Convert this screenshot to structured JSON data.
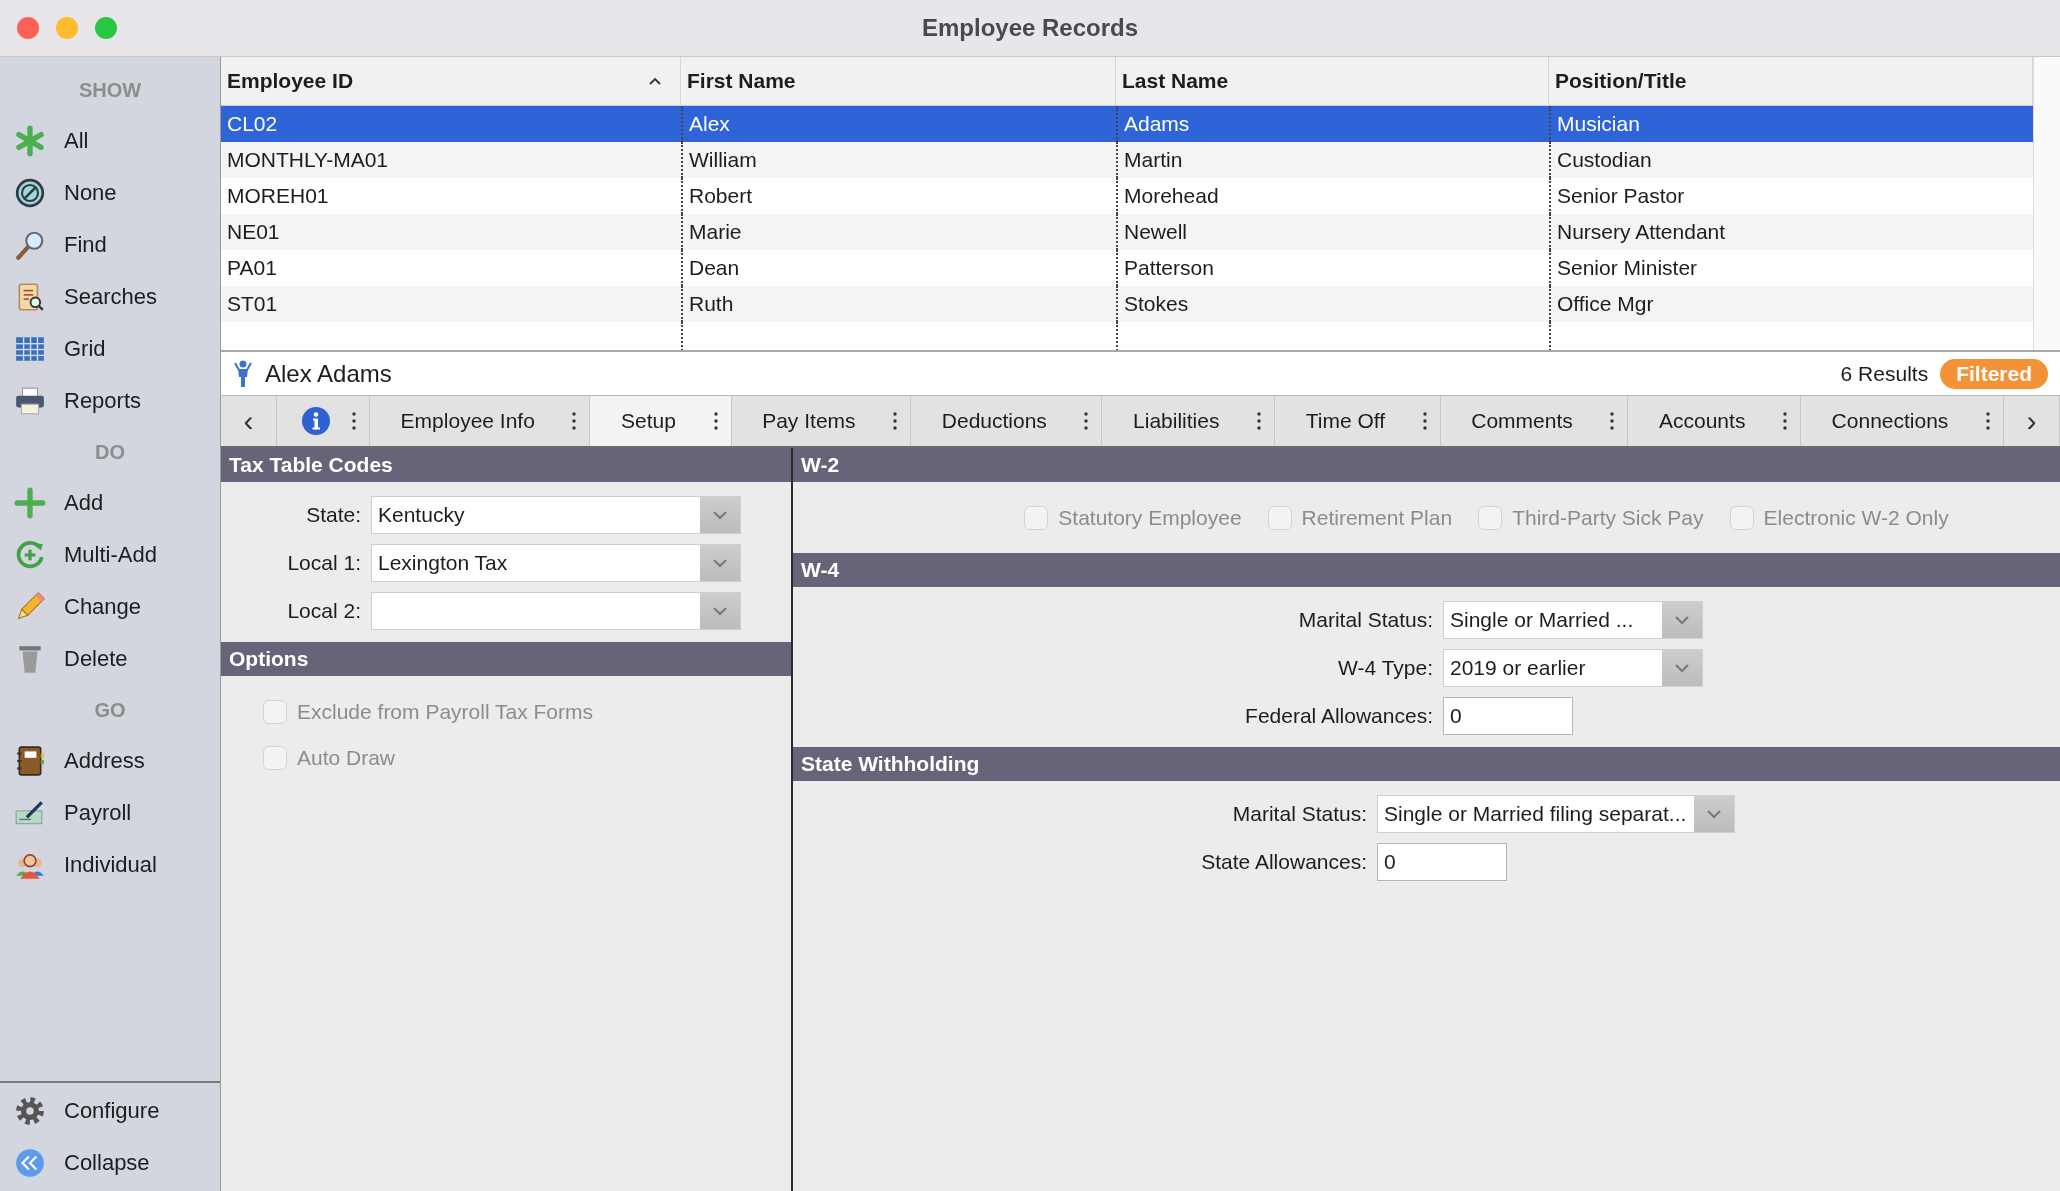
{
  "window": {
    "title": "Employee Records"
  },
  "sidebar": {
    "sections": [
      {
        "heading": "SHOW",
        "items": [
          {
            "label": "All"
          },
          {
            "label": "None"
          },
          {
            "label": "Find"
          },
          {
            "label": "Searches"
          },
          {
            "label": "Grid"
          },
          {
            "label": "Reports"
          }
        ]
      },
      {
        "heading": "DO",
        "items": [
          {
            "label": "Add"
          },
          {
            "label": "Multi-Add"
          },
          {
            "label": "Change"
          },
          {
            "label": "Delete"
          }
        ]
      },
      {
        "heading": "GO",
        "items": [
          {
            "label": "Address"
          },
          {
            "label": "Payroll"
          },
          {
            "label": "Individual"
          }
        ]
      }
    ],
    "footer": [
      {
        "label": "Configure"
      },
      {
        "label": "Collapse"
      }
    ]
  },
  "table": {
    "columns": [
      {
        "label": "Employee ID",
        "sorted": true
      },
      {
        "label": "First Name",
        "sorted": false
      },
      {
        "label": "Last Name",
        "sorted": false
      },
      {
        "label": "Position/Title",
        "sorted": false
      }
    ],
    "rows": [
      {
        "cells": [
          "CL02",
          "Alex",
          "Adams",
          "Musician"
        ],
        "selected": true
      },
      {
        "cells": [
          "MONTHLY-MA01",
          "William",
          "Martin",
          "Custodian"
        ],
        "selected": false
      },
      {
        "cells": [
          "MOREH01",
          "Robert",
          "Morehead",
          "Senior Pastor"
        ],
        "selected": false
      },
      {
        "cells": [
          "NE01",
          "Marie",
          "Newell",
          "Nursery Attendant"
        ],
        "selected": false
      },
      {
        "cells": [
          "PA01",
          "Dean",
          "Patterson",
          "Senior Minister"
        ],
        "selected": false
      },
      {
        "cells": [
          "ST01",
          "Ruth",
          "Stokes",
          "Office Mgr"
        ],
        "selected": false
      }
    ]
  },
  "record": {
    "name": "Alex Adams",
    "results": "6 Results",
    "filter_badge": "Filtered"
  },
  "tabs": {
    "prev": "‹",
    "next": "›",
    "items": [
      {
        "kind": "icon",
        "selected": false
      },
      {
        "kind": "text",
        "label": "Employee Info",
        "selected": false
      },
      {
        "kind": "text",
        "label": "Setup",
        "selected": true
      },
      {
        "kind": "text",
        "label": "Pay Items",
        "selected": false
      },
      {
        "kind": "text",
        "label": "Deductions",
        "selected": false
      },
      {
        "kind": "text",
        "label": "Liabilities",
        "selected": false
      },
      {
        "kind": "text",
        "label": "Time Off",
        "selected": false
      },
      {
        "kind": "text",
        "label": "Comments",
        "selected": false
      },
      {
        "kind": "text",
        "label": "Accounts",
        "selected": false
      },
      {
        "kind": "text",
        "label": "Connections",
        "selected": false
      }
    ]
  },
  "left_panel": {
    "sections": [
      {
        "title": "Tax Table Codes",
        "kind": "form",
        "fields": [
          {
            "label": "State:",
            "kind": "dropdown",
            "value": "Kentucky"
          },
          {
            "label": "Local 1:",
            "kind": "dropdown",
            "value": "Lexington Tax"
          },
          {
            "label": "Local 2:",
            "kind": "dropdown"
          }
        ]
      },
      {
        "title": "Options",
        "kind": "checklist",
        "options": [
          {
            "label": "Exclude from Payroll Tax Forms",
            "checked": false,
            "disabled": true
          },
          {
            "label": "Auto Draw",
            "checked": false,
            "disabled": true
          }
        ]
      }
    ]
  },
  "right_panel": {
    "sections": [
      {
        "title": "W-2",
        "kind": "checkrow",
        "options": [
          {
            "label": "Statutory Employee",
            "checked": false,
            "disabled": true
          },
          {
            "label": "Retirement Plan",
            "checked": false,
            "disabled": true
          },
          {
            "label": "Third-Party Sick Pay",
            "checked": false,
            "disabled": true
          },
          {
            "label": "Electronic W-2 Only",
            "checked": false,
            "disabled": true
          }
        ]
      },
      {
        "title": "W-4",
        "kind": "form",
        "fields": [
          {
            "label": "Marital Status:",
            "kind": "dropdown",
            "value": "Single or Married ..."
          },
          {
            "label": "W-4 Type:",
            "kind": "dropdown",
            "value": "2019 or earlier"
          },
          {
            "label": "Federal Allowances:",
            "kind": "text",
            "value": "0"
          }
        ]
      },
      {
        "title": "State Withholding",
        "kind": "form",
        "fields": [
          {
            "label": "Marital Status:",
            "kind": "dropdown",
            "value": "Single or Married filing separat..."
          },
          {
            "label": "State Allowances:",
            "kind": "text",
            "value": "0"
          }
        ]
      }
    ]
  }
}
